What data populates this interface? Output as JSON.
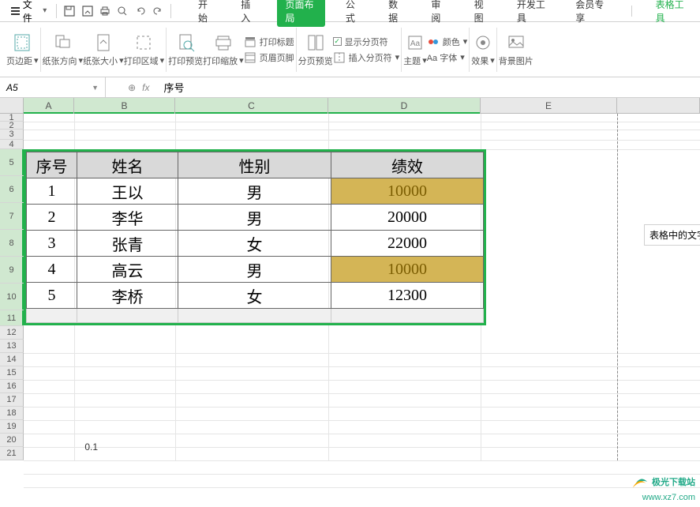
{
  "menubar": {
    "file": "文件",
    "tabs": [
      "开始",
      "插入",
      "页面布局",
      "公式",
      "数据",
      "审阅",
      "视图",
      "开发工具",
      "会员专享"
    ],
    "activeTab": 2,
    "special": "表格工具"
  },
  "ribbon": {
    "margins": "页边距",
    "orientation": "纸张方向",
    "size": "纸张大小",
    "printArea": "打印区域",
    "printPreview": "打印预览",
    "printScale": "打印缩放",
    "printTitles": "打印标题",
    "headerFooter": "页眉页脚",
    "pagePreview": "分页预览",
    "showBreaks": "显示分页符",
    "insertBreaks": "插入分页符",
    "themes": "主题",
    "colors": "颜色",
    "fonts": "Aa 字体",
    "effects": "效果",
    "bgImage": "背景图片"
  },
  "formulaBar": {
    "nameBox": "A5",
    "fx": "fx",
    "value": "序号"
  },
  "columns": [
    "A",
    "B",
    "C",
    "D",
    "E"
  ],
  "rows": [
    "1",
    "2",
    "3",
    "4",
    "5",
    "6",
    "7",
    "8",
    "9",
    "10",
    "11",
    "12",
    "13",
    "14",
    "15",
    "16",
    "17",
    "18",
    "19",
    "20",
    "21"
  ],
  "chart_data": {
    "type": "table",
    "headers": [
      "序号",
      "姓名",
      "性别",
      "绩效"
    ],
    "rows": [
      {
        "序号": "1",
        "姓名": "王以",
        "性别": "男",
        "绩效": "10000",
        "highlight": true
      },
      {
        "序号": "2",
        "姓名": "李华",
        "性别": "男",
        "绩效": "20000",
        "highlight": false
      },
      {
        "序号": "3",
        "姓名": "张青",
        "性别": "女",
        "绩效": "22000",
        "highlight": false
      },
      {
        "序号": "4",
        "姓名": "高云",
        "性别": "男",
        "绩效": "10000",
        "highlight": true
      },
      {
        "序号": "5",
        "姓名": "李桥",
        "性别": "女",
        "绩效": "12300",
        "highlight": false
      }
    ]
  },
  "sideNote": "表格中的文字太",
  "strayValue": "0.1",
  "watermark": {
    "brand": "极光下载站",
    "url": "www.xz7.com"
  }
}
